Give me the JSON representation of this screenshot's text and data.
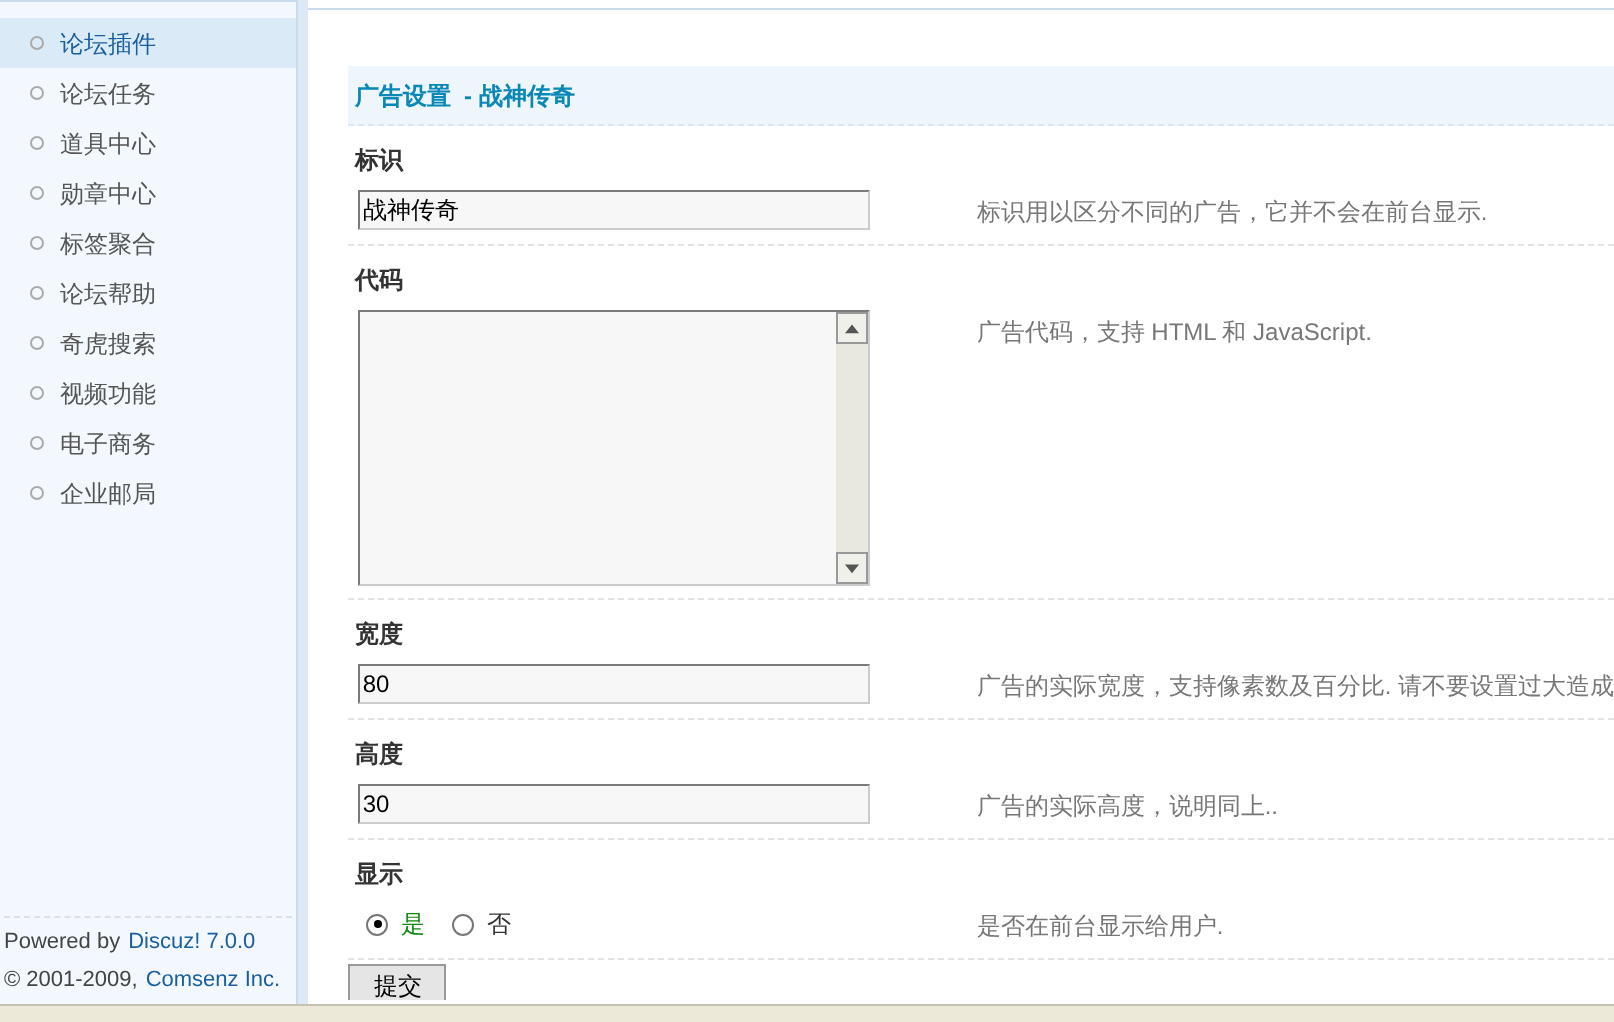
{
  "sidebar": {
    "items": [
      {
        "label": "论坛插件",
        "selected": true
      },
      {
        "label": "论坛任务",
        "selected": false
      },
      {
        "label": "道具中心",
        "selected": false
      },
      {
        "label": "勋章中心",
        "selected": false
      },
      {
        "label": "标签聚合",
        "selected": false
      },
      {
        "label": "论坛帮助",
        "selected": false
      },
      {
        "label": "奇虎搜索",
        "selected": false
      },
      {
        "label": "视频功能",
        "selected": false
      },
      {
        "label": "电子商务",
        "selected": false
      },
      {
        "label": "企业邮局",
        "selected": false
      }
    ],
    "footer": {
      "powered_prefix": "Powered by",
      "powered_link": "Discuz! 7.0.0",
      "copyright_prefix": "© 2001-2009,",
      "copyright_link": "Comsenz Inc."
    }
  },
  "panel": {
    "title": "广告设置  - 战神传奇",
    "rows": [
      {
        "kind": "text",
        "label": "标识",
        "value": "战神传奇",
        "description": "标识用以区分不同的广告，它并不会在前台显示."
      },
      {
        "kind": "textarea",
        "label": "代码",
        "description": "广告代码，支持 HTML 和 JavaScript."
      },
      {
        "kind": "text",
        "label": "宽度",
        "value": "80",
        "description": "广告的实际宽度，支持像素数及百分比. 请不要设置过大造成"
      },
      {
        "kind": "text",
        "label": "高度",
        "value": "30",
        "description": "广告的实际高度，说明同上.."
      },
      {
        "kind": "radio",
        "label": "显示",
        "options": [
          {
            "label": "是",
            "selected": true
          },
          {
            "label": "否",
            "selected": false
          }
        ],
        "description": "是否在前台显示给用户."
      }
    ],
    "submit": "提交"
  }
}
